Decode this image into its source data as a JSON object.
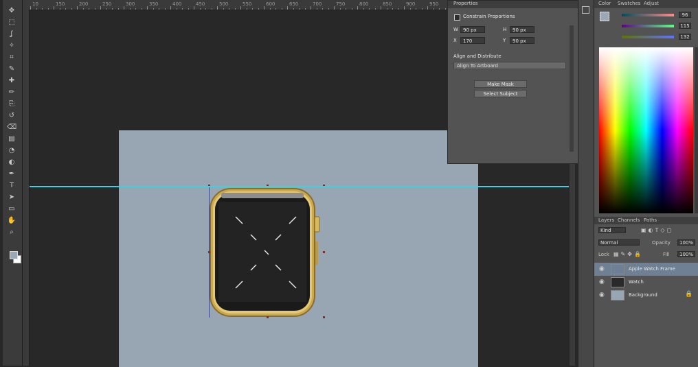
{
  "colors": {
    "canvas": "#282828",
    "artboard": "#98a6b3",
    "guide": "#3fd1e0",
    "watch_body": "#c2a24c",
    "watch_screen": "#1c1c1c",
    "selected_layer": "#6f7f94"
  },
  "ruler": {
    "labels": [
      "10",
      "150",
      "200",
      "250",
      "300",
      "350",
      "400",
      "450",
      "500",
      "550",
      "600",
      "650",
      "700",
      "750",
      "800",
      "850",
      "900",
      "950"
    ]
  },
  "toolbar": {
    "tools": [
      "move-tool",
      "marquee-tool",
      "lasso-tool",
      "quick-select-tool",
      "crop-tool",
      "eyedropper-tool",
      "healing-tool",
      "brush-tool",
      "stamp-tool",
      "history-brush-tool",
      "eraser-tool",
      "gradient-tool",
      "blur-tool",
      "dodge-tool",
      "pen-tool",
      "type-tool",
      "path-select-tool",
      "shape-tool",
      "hand-tool",
      "zoom-tool"
    ]
  },
  "dialog": {
    "title": "Properties",
    "checkbox_label": "Constrain Proportions",
    "w_label": "W",
    "w_value": "90 px",
    "h_label": "H",
    "h_value": "90 px",
    "x_label": "X",
    "x_value": "170",
    "y_label": "Y",
    "y_value": "90 px",
    "section_label": "Align and Distribute",
    "select_value": "Align To Artboard",
    "button_1": "Make Mask",
    "button_2": "Select Subject"
  },
  "color_panel": {
    "tabs": [
      "Color",
      "Swatches",
      "Adjust"
    ],
    "r_value": "96",
    "g_value": "115",
    "b_value": "132"
  },
  "layers_panel": {
    "tabs": [
      "Layers",
      "Channels",
      "Paths"
    ],
    "kind_label": "Kind",
    "blend_mode": "Normal",
    "opacity_label": "Opacity",
    "opacity_value": "100%",
    "lock_label": "Lock",
    "fill_label": "Fill",
    "fill_value": "100%",
    "layers": [
      {
        "name": "Apple Watch Frame",
        "thumb": "#6f7f94",
        "selected": true
      },
      {
        "name": "Watch",
        "thumb": "#2a2a2a",
        "selected": false
      },
      {
        "name": "Background",
        "thumb": "#98a6b3",
        "selected": false
      }
    ]
  }
}
